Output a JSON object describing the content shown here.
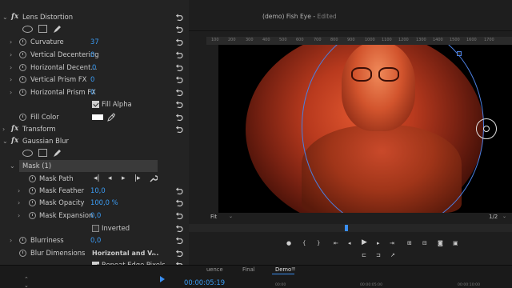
{
  "effect_controls": {
    "lens_distortion": {
      "name": "Lens Distortion",
      "curvature": {
        "label": "Curvature",
        "value": "37"
      },
      "vertical_decentering": {
        "label": "Vertical Decentering",
        "value": "0"
      },
      "horizontal_decentering": {
        "label": "Horizontal Decent...",
        "value": "0"
      },
      "vertical_prism_fx": {
        "label": "Vertical Prism FX",
        "value": "0"
      },
      "horizontal_prism_fx": {
        "label": "Horizontal Prism FX",
        "value": "0"
      },
      "fill_alpha": {
        "label": "Fill Alpha",
        "checked": true
      },
      "fill_color": {
        "label": "Fill Color",
        "color": "#ffffff"
      }
    },
    "transform": {
      "name": "Transform"
    },
    "gaussian_blur": {
      "name": "Gaussian Blur",
      "mask": {
        "label": "Mask (1)"
      },
      "mask_path": {
        "label": "Mask Path"
      },
      "mask_feather": {
        "label": "Mask Feather",
        "value": "10,0"
      },
      "mask_opacity": {
        "label": "Mask Opacity",
        "value": "100,0 %"
      },
      "mask_expansion": {
        "label": "Mask Expansion",
        "value": "0,0"
      },
      "inverted": {
        "label": "Inverted",
        "checked": false
      },
      "blurriness": {
        "label": "Blurriness",
        "value": "0,0"
      },
      "blur_dimensions": {
        "label": "Blur Dimensions",
        "value": "Horizontal and V..."
      },
      "repeat_edge_pixels": {
        "label": "Repeat Edge Pixels",
        "checked": true
      }
    }
  },
  "program_monitor": {
    "title": "(demo) Fish Eye",
    "status": "Edited",
    "ruler_ticks": [
      "100",
      "200",
      "300",
      "400",
      "500",
      "600",
      "700",
      "800",
      "900",
      "1000",
      "1100",
      "1200",
      "1300",
      "1400",
      "1500",
      "1600",
      "1700"
    ],
    "fit": "Fit",
    "resolution": "1/2"
  },
  "timeline": {
    "tabs": [
      "uence",
      "Final",
      "Demo"
    ],
    "active_tab": "Demo",
    "timecode": "00:00:05:19",
    "ruler": [
      "00:00",
      "00:00:05:00",
      "00:00:10:00"
    ]
  },
  "colors": {
    "accent": "#3b9cf4",
    "mask_outline": "#4b7fe0",
    "panel_bg": "#232323"
  }
}
